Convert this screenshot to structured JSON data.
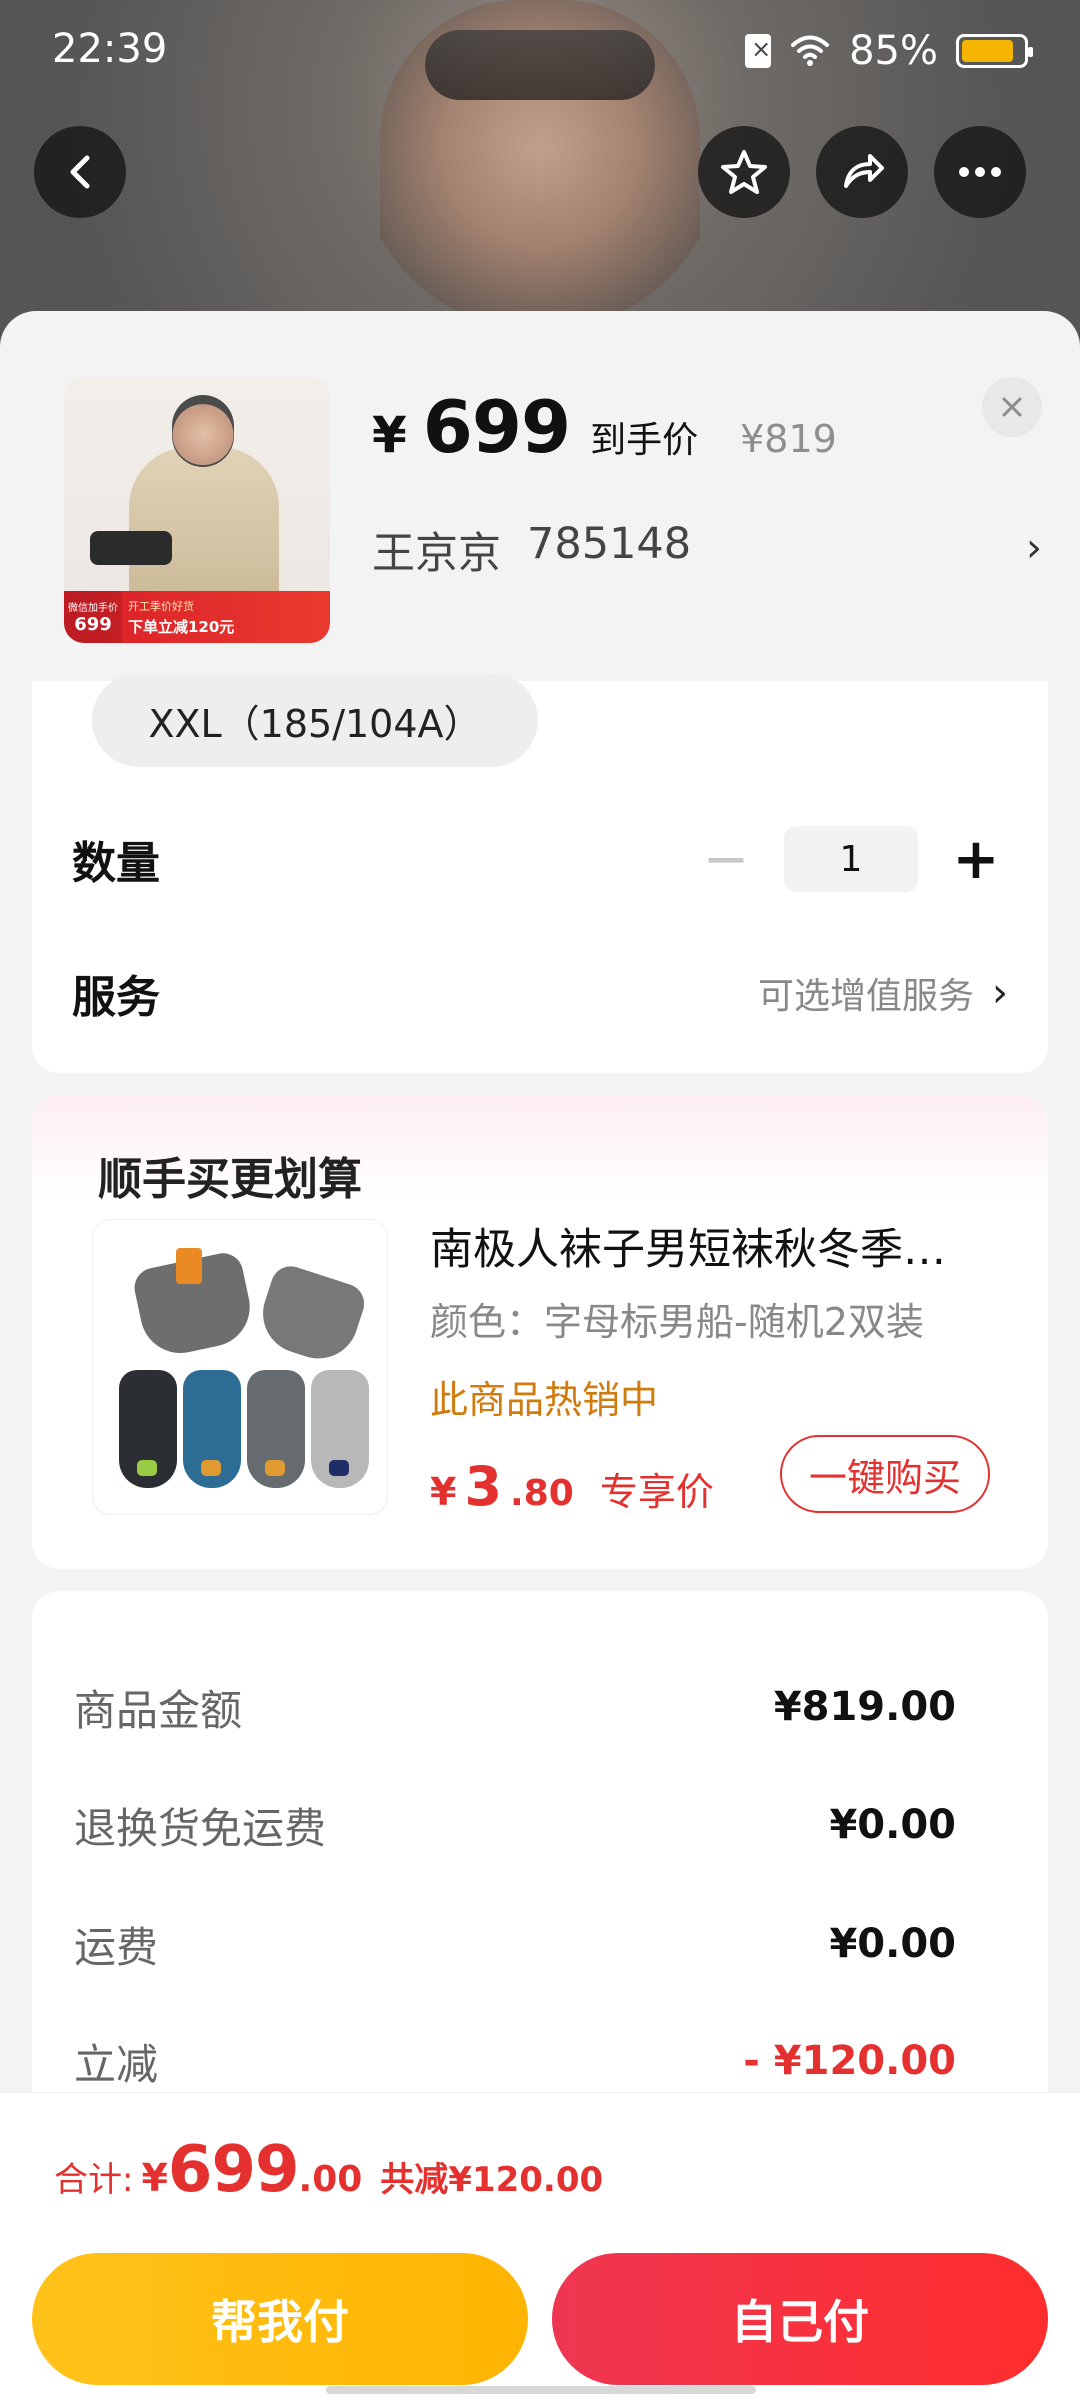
{
  "status_bar": {
    "time": "22:39",
    "battery_percent": "85%",
    "icons": [
      "sim-disabled-icon",
      "wifi-icon",
      "battery-icon"
    ],
    "battery_level": 0.85,
    "battery_color": "#f6b500"
  },
  "top_actions": {
    "back_icon": "back-arrow-icon",
    "favorite_icon": "star-icon",
    "share_icon": "share-icon",
    "more_icon": "more-icon"
  },
  "product": {
    "thumbnail_badges": {
      "left_small": "微信加手价",
      "left_price": "699",
      "mid_top": "开工季价好货",
      "mid_bottom": "下单立减120元"
    },
    "currency_symbol": "¥",
    "final_price": "699",
    "final_price_label": "到手价",
    "original_price": "¥819",
    "color_name": "王京京",
    "sku_code": "785148",
    "close_icon": "close-icon",
    "spec_arrow_icon": "chevron-right-icon"
  },
  "selection": {
    "size_chip": "XXL（185/104A）",
    "quantity_label": "数量",
    "quantity_value": "1",
    "minus_symbol": "−",
    "plus_symbol": "+",
    "service_label": "服务",
    "service_hint": "可选增值服务",
    "service_arrow": "›"
  },
  "recommendation": {
    "title": "顺手买更划算",
    "product_name": "南极人袜子男短袜秋冬季…",
    "variant": "颜色：字母标男船-随机2双装",
    "hot_text": "此商品热销中",
    "price_currency": "¥",
    "price_int": "3",
    "price_decimal": ".80",
    "price_label": "专享价",
    "buy_button": "一键购买"
  },
  "amounts": {
    "rows": [
      {
        "label": "商品金额",
        "value": "¥819.00"
      },
      {
        "label": "退换货免运费",
        "value": "¥0.00"
      },
      {
        "label": "运费",
        "value": "¥0.00"
      },
      {
        "label": "立减",
        "value": "- ¥120.00"
      }
    ]
  },
  "bottom_bar": {
    "total_label": "合计:",
    "total_currency": "¥",
    "total_int": "699",
    "total_decimal": ".00",
    "total_discount": "共减¥120.00",
    "help_pay": "帮我付",
    "self_pay": "自己付"
  },
  "colors": {
    "accent_red": "#e4312f",
    "orange_hot": "#d07b0e",
    "help_pay_yellow": "#ffc21a",
    "self_pay_red": "#ff2d2d"
  }
}
